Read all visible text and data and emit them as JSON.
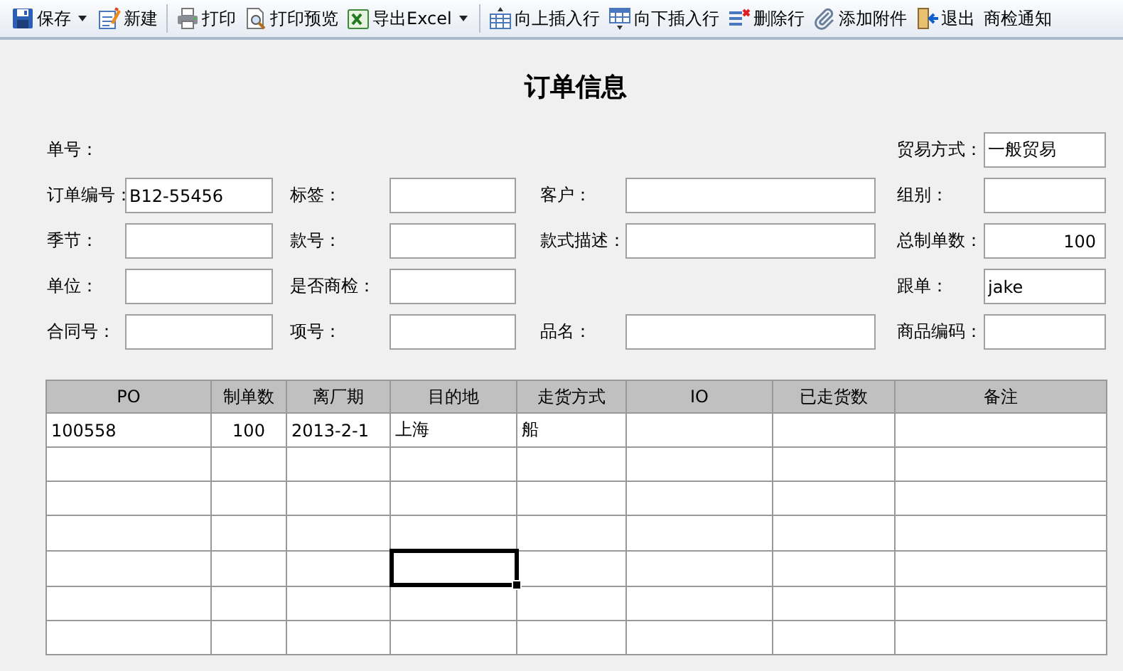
{
  "toolbar": [
    {
      "kind": "button",
      "label": "保存",
      "dropdown": true
    },
    {
      "kind": "button",
      "label": "新建",
      "dropdown": false
    },
    {
      "kind": "separator"
    },
    {
      "kind": "button",
      "label": "打印",
      "dropdown": false
    },
    {
      "kind": "button",
      "label": "打印预览",
      "dropdown": false
    },
    {
      "kind": "button",
      "label": "导出Excel",
      "dropdown": true
    },
    {
      "kind": "separator"
    },
    {
      "kind": "button",
      "label": "向上插入行",
      "dropdown": false
    },
    {
      "kind": "button",
      "label": "向下插入行",
      "dropdown": false
    },
    {
      "kind": "button",
      "label": "删除行",
      "dropdown": false
    },
    {
      "kind": "button",
      "label": "添加附件",
      "dropdown": false
    },
    {
      "kind": "button",
      "label": "退出",
      "dropdown": false
    },
    {
      "kind": "button",
      "label": "商检通知",
      "dropdown": false
    }
  ],
  "title": "订单信息",
  "form_rows": [
    [
      {
        "label": "单号：",
        "kind": "label"
      },
      null,
      null,
      {
        "label": "贸易方式：",
        "kind": "text",
        "value": "一般贸易"
      }
    ],
    [
      {
        "label": "订单编号：",
        "kind": "text",
        "value": "B12-55456"
      },
      {
        "label": "标签：",
        "kind": "text"
      },
      {
        "label": "客户：",
        "kind": "text"
      },
      {
        "label": "组别：",
        "kind": "text"
      }
    ],
    [
      {
        "label": "季节：",
        "kind": "text"
      },
      {
        "label": "款号：",
        "kind": "text"
      },
      {
        "label": "款式描述：",
        "kind": "text"
      },
      {
        "label": "总制单数：",
        "kind": "number",
        "value": "100"
      }
    ],
    [
      {
        "label": "单位：",
        "kind": "text"
      },
      {
        "label": "是否商检：",
        "kind": "text"
      },
      null,
      {
        "label": "跟单：",
        "kind": "text",
        "value": "jake"
      }
    ],
    [
      {
        "label": "合同号：",
        "kind": "text"
      },
      {
        "label": "项号：",
        "kind": "text"
      },
      {
        "label": "品名：",
        "kind": "text"
      },
      {
        "label": "商品编码：",
        "kind": "text"
      }
    ]
  ],
  "table": {
    "columns": [
      {
        "label": "PO",
        "kind": "text"
      },
      {
        "label": "制单数",
        "kind": "number"
      },
      {
        "label": "离厂期",
        "kind": "text"
      },
      {
        "label": "目的地",
        "kind": "text"
      },
      {
        "label": "走货方式",
        "kind": "text"
      },
      {
        "label": "IO",
        "kind": "text"
      },
      {
        "label": "已走货数",
        "kind": "text"
      },
      {
        "label": "备注",
        "kind": "text"
      }
    ],
    "rows": [
      [
        {
          "text": "100558",
          "selected": false
        },
        {
          "text": "100",
          "selected": false
        },
        {
          "text": "2013-2-1",
          "selected": false
        },
        {
          "text": "上海",
          "selected": false
        },
        {
          "text": "船",
          "selected": false
        },
        {
          "selected": false
        },
        {
          "selected": false
        },
        {
          "selected": false
        }
      ],
      [
        {
          "selected": false
        },
        {
          "selected": false
        },
        {
          "selected": false
        },
        {
          "selected": false
        },
        {
          "selected": false
        },
        {
          "selected": false
        },
        {
          "selected": false
        },
        {
          "selected": false
        }
      ],
      [
        {
          "selected": false
        },
        {
          "selected": false
        },
        {
          "selected": false
        },
        {
          "selected": false
        },
        {
          "selected": false
        },
        {
          "selected": false
        },
        {
          "selected": false
        },
        {
          "selected": false
        }
      ],
      [
        {
          "selected": false
        },
        {
          "selected": false
        },
        {
          "selected": false
        },
        {
          "selected": false
        },
        {
          "selected": false
        },
        {
          "selected": false
        },
        {
          "selected": false
        },
        {
          "selected": false
        }
      ],
      [
        {
          "selected": false
        },
        {
          "selected": false
        },
        {
          "selected": false
        },
        {
          "selected": true
        },
        {
          "selected": false
        },
        {
          "selected": false
        },
        {
          "selected": false
        },
        {
          "selected": false
        }
      ],
      [
        {
          "selected": false
        },
        {
          "selected": false
        },
        {
          "selected": false
        },
        {
          "selected": false
        },
        {
          "selected": false
        },
        {
          "selected": false
        },
        {
          "selected": false
        },
        {
          "selected": false
        }
      ],
      [
        {
          "selected": false
        },
        {
          "selected": false
        },
        {
          "selected": false
        },
        {
          "selected": false
        },
        {
          "selected": false
        },
        {
          "selected": false
        },
        {
          "selected": false
        },
        {
          "selected": false
        }
      ]
    ]
  }
}
